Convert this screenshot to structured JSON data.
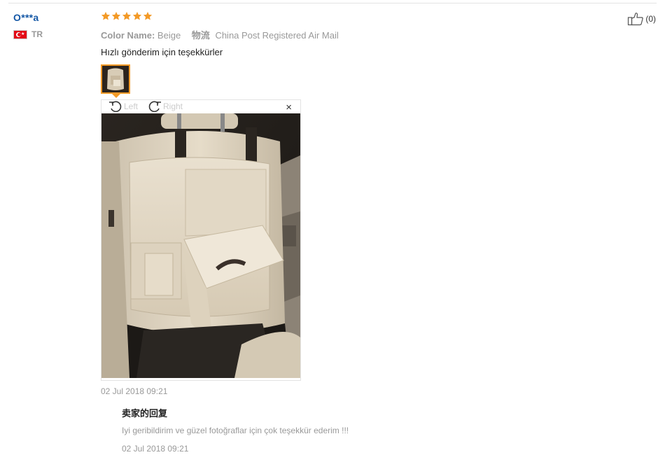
{
  "reviewer": {
    "name": "O***a",
    "country_code": "TR"
  },
  "review": {
    "rating": 5,
    "color_label": "Color Name:",
    "color_value": "Beige",
    "shipping_label": "物流",
    "shipping_value": "China Post Registered Air Mail",
    "text": "Hızlı gönderim için teşekkürler",
    "date": "02 Jul 2018 09:21",
    "helpful_count": "(0)"
  },
  "viewer": {
    "rotate_left": "Left",
    "rotate_right": "Right",
    "close": "×"
  },
  "reply": {
    "title": "卖家的回复",
    "text": "Iyi geribildirim ve güzel fotoğraflar için çok teşekkür ederim !!!",
    "date": "02 Jul 2018 09:21"
  },
  "colors": {
    "star": "#f39a27",
    "username": "#1558a6",
    "thumb_border": "#f39a27"
  }
}
